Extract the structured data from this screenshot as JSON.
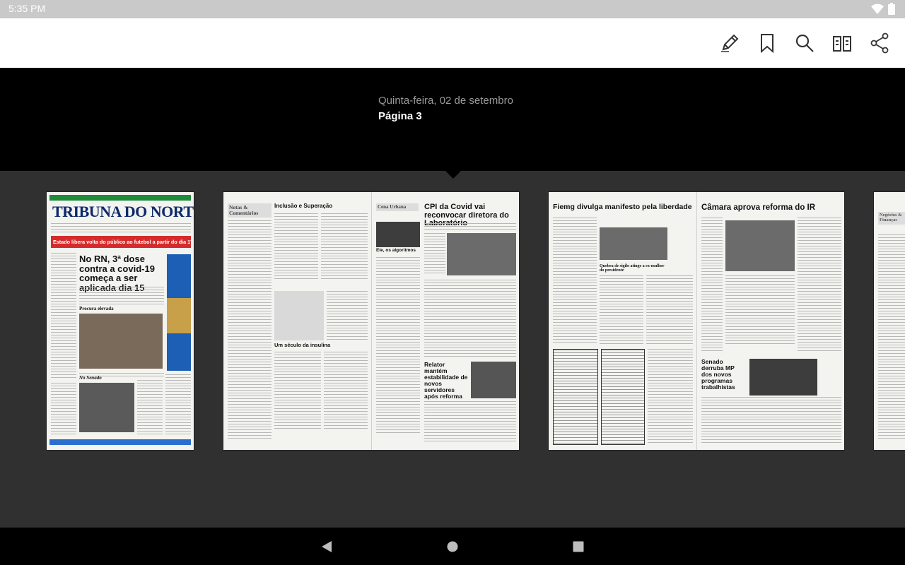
{
  "status_bar": {
    "time": "5:35 PM",
    "icons": [
      "wifi-icon",
      "battery-icon"
    ]
  },
  "toolbar": {
    "icons": [
      "pencil-icon",
      "bookmark-icon",
      "search-icon",
      "page-layout-icon",
      "share-icon"
    ]
  },
  "issue": {
    "date": "Quinta-feira, 02 de setembro",
    "page": "Página 3"
  },
  "pages": {
    "front": {
      "masthead": "TRIBUNA DO NORTE",
      "banner": "Estado libera volta do público ao futebol a partir do dia 17",
      "headline": "No RN, 3ª dose contra a covid-19 começa a ser aplicada dia 15",
      "subhead": "Procura elevada",
      "section": "No Senado"
    },
    "spread1": {
      "left_section": "Notas & Comentários",
      "left_headline": "Inclusão e Superação",
      "left_headline2": "Um século da insulina",
      "right_kicker": "Cena Urbana",
      "right_headline": "CPI da Covid vai reconvocar diretora do Laboratório",
      "right_headline2": "Relator mantém estabilidade de novos servidores após reforma",
      "right_sub": "Ele, os algoritmos"
    },
    "spread2": {
      "left_headline": "Fiemg divulga manifesto pela liberdade",
      "left_sub": "Quebra de sigilo atinge a ex-mulher do presidente",
      "right_headline": "Câmara aprova reforma do IR",
      "right_headline2": "Senado derruba MP dos novos programas trabalhistas"
    },
    "partial": {
      "section": "Negócios & Finanças"
    }
  },
  "nav": {
    "icons": [
      "back-icon",
      "home-icon",
      "recents-icon"
    ]
  },
  "colors": {
    "status_bar": "#c9c9c9",
    "toolbar": "#ffffff",
    "background": "#000000",
    "strip": "#303030",
    "banner_red": "#d52b2b"
  }
}
